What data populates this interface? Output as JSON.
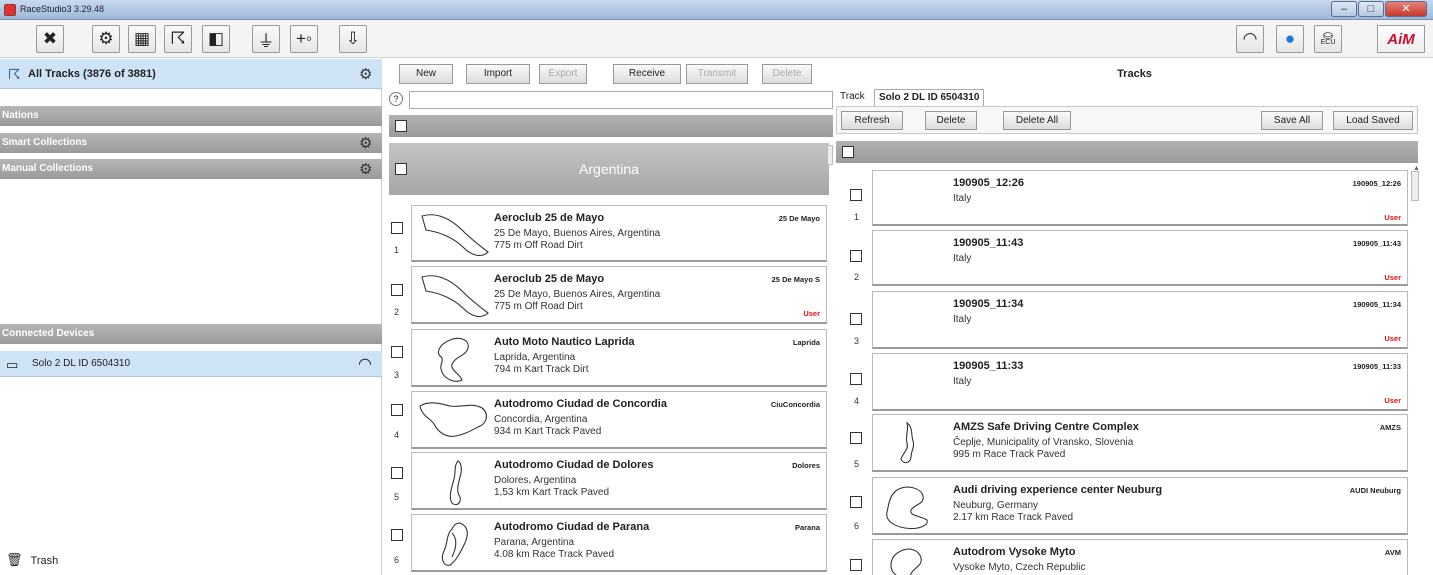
{
  "window": {
    "title": "RaceStudio3 3.29.48"
  },
  "toolbar": {
    "left_icons": [
      "tools-icon",
      "gear-icon",
      "device-grid-icon",
      "tracks-icon",
      "dashboard-icon",
      "ground-icon",
      "add-sensor-icon",
      "download-icon"
    ],
    "right_icons": [
      "wifi-icon",
      "chat-icon",
      "ecu-icon"
    ],
    "ecu_label": "ECU",
    "logo": "AiM"
  },
  "sidebar": {
    "all_tracks_label": "All Tracks  (3876 of 3881)",
    "sections": [
      "Nations",
      "Smart Collections",
      "Manual Collections"
    ],
    "connected_devices_label": "Connected Devices",
    "device_label": "Solo 2 DL ID 6504310",
    "trash_label": "Trash"
  },
  "middle": {
    "buttons": [
      {
        "label": "New",
        "enabled": true
      },
      {
        "label": "Import",
        "enabled": true
      },
      {
        "label": "Export",
        "enabled": false
      },
      {
        "label": "Receive",
        "enabled": true
      },
      {
        "label": "Transmit",
        "enabled": false
      },
      {
        "label": "Delete",
        "enabled": false
      }
    ],
    "help_glyph": "?",
    "search_value": "",
    "group_name": "Argentina",
    "tracks": [
      {
        "num": "1",
        "name": "Aeroclub 25 de Mayo",
        "location": "25 De Mayo, Buenos Aires, Argentina",
        "info": "775 m Off Road Dirt",
        "short": "25 De Mayo",
        "user": ""
      },
      {
        "num": "2",
        "name": "Aeroclub 25 de Mayo",
        "location": "25 De Mayo, Buenos Aires, Argentina",
        "info": "775 m Off Road Dirt",
        "short": "25 De Mayo S",
        "user": "User"
      },
      {
        "num": "3",
        "name": "Auto Moto Nautico Laprida",
        "location": "Laprida, Argentina",
        "info": "794 m Kart Track Dirt",
        "short": "Laprida",
        "user": ""
      },
      {
        "num": "4",
        "name": "Autodromo Ciudad de Concordia",
        "location": "Concordia, Argentina",
        "info": "934 m Kart Track Paved",
        "short": "CiuConcordia",
        "user": ""
      },
      {
        "num": "5",
        "name": "Autodromo Ciudad de Dolores",
        "location": "Dolores, Argentina",
        "info": "1,53 km Kart Track Paved",
        "short": "Dolores",
        "user": ""
      },
      {
        "num": "6",
        "name": "Autodromo Ciudad de Parana",
        "location": "Parana, Argentina",
        "info": "4.08 km Race Track Paved",
        "short": "Parana",
        "user": ""
      }
    ]
  },
  "right": {
    "title": "Tracks",
    "track_label": "Track",
    "device_tab": "Solo 2 DL ID 6504310",
    "buttons_left": [
      "Refresh",
      "Delete",
      "Delete All"
    ],
    "buttons_right": [
      "Save All",
      "Load Saved"
    ],
    "tracks": [
      {
        "num": "1",
        "name": "190905_12:26",
        "location": "Italy",
        "info": "",
        "short": "190905_12:26",
        "user": "User"
      },
      {
        "num": "2",
        "name": "190905_11:43",
        "location": "Italy",
        "info": "",
        "short": "190905_11:43",
        "user": "User"
      },
      {
        "num": "3",
        "name": "190905_11:34",
        "location": "Italy",
        "info": "",
        "short": "190905_11:34",
        "user": "User"
      },
      {
        "num": "4",
        "name": "190905_11:33",
        "location": "Italy",
        "info": "",
        "short": "190905_11:33",
        "user": "User"
      },
      {
        "num": "5",
        "name": "AMZS Safe Driving Centre Complex",
        "location": "Čeplje, Municipality of Vransko, Slovenia",
        "info": "995 m Race Track Paved",
        "short": "AMZS",
        "user": ""
      },
      {
        "num": "6",
        "name": "Audi driving experience center Neuburg",
        "location": "Neuburg, Germany",
        "info": "2.17 km Race Track Paved",
        "short": "AUDI Neuburg",
        "user": ""
      },
      {
        "num": "",
        "name": "Autodrom Vysoke Myto",
        "location": "Vysoke Myto, Czech Republic",
        "info": "",
        "short": "AVM",
        "user": ""
      }
    ]
  }
}
